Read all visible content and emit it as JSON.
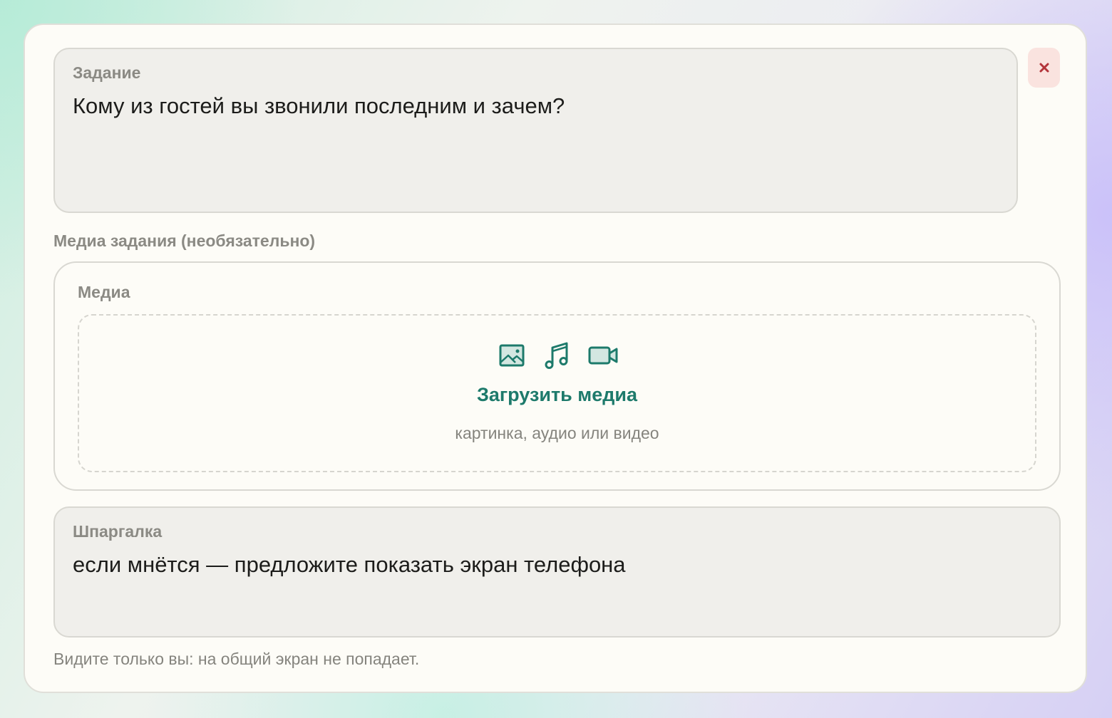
{
  "task": {
    "label": "Задание",
    "value": "Кому из гостей вы звонили последним и зачем?"
  },
  "close_button": {
    "icon": "close-icon",
    "color": "#b3343a"
  },
  "media_section": {
    "label": "Медиа задания (необязательно)",
    "box_label": "Медиа",
    "icons": [
      "image-icon",
      "music-icon",
      "video-camera-icon"
    ],
    "upload_title": "Загрузить медиа",
    "upload_hint": "картинка, аудио или видео",
    "accent_color": "#1d7a6b"
  },
  "hint": {
    "label": "Шпаргалка",
    "value": "если мнётся — предложите показать экран телефона",
    "note": "Видите только вы: на общий экран не попадает."
  }
}
